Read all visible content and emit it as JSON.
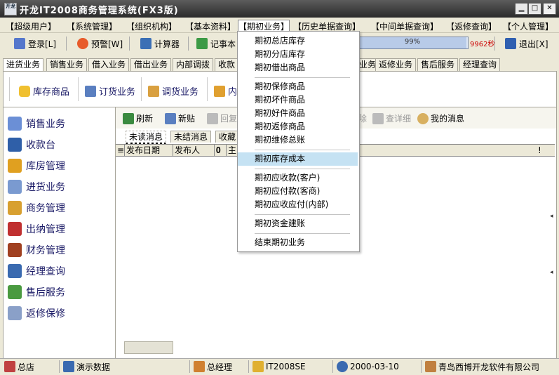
{
  "window": {
    "title": "开龙IT2008商务管理系统(FX3版)",
    "app_icon_text": "开龙",
    "minimize": "▁",
    "maximize": "□",
    "close": "✕"
  },
  "menubar": [
    "【超级用户】",
    "【系统管理】",
    "【组织机构】",
    "【基本资料】",
    "【期初业务】",
    "【历史单据查询】",
    "【中间单据查询】",
    "【返修查询】",
    "【个人管理】"
  ],
  "toolbar": {
    "login": "登录[L]",
    "alert": "预警[W]",
    "calculator": "计算器",
    "notepad": "记事本",
    "progress_text": "99%",
    "progress_value": 0.99,
    "sms_count": "9962秒",
    "logout": "退出[X]"
  },
  "tabs": [
    "进货业务",
    "销售业务",
    "借入业务",
    "借出业务",
    "内部调拨",
    "收款",
    "业务",
    "返修业务",
    "售后服务",
    "经理查询"
  ],
  "subpanel": {
    "inventory": "库存商品",
    "order": "订货业务",
    "transfer": "调货业务",
    "internal": "内"
  },
  "leftnav": [
    "销售业务",
    "收款台",
    "库房管理",
    "进货业务",
    "商务管理",
    "出纳管理",
    "财务管理",
    "经理查询",
    "售后服务",
    "返修保修"
  ],
  "main_toolbar": {
    "refresh": "刷新",
    "new_post": "新贴",
    "reply": "回复",
    "delete": "除",
    "details": "查详细",
    "my_messages": "我的消息"
  },
  "message_tabs": [
    "未读消息",
    "未结消息",
    "收藏"
  ],
  "grid_columns": [
    "发布日期",
    "发布人",
    "主"
  ],
  "dropdown": {
    "group1": [
      "期初总店库存",
      "期初分店库存",
      "期初借出商品"
    ],
    "group2": [
      "期初保修商品",
      "期初坏件商品",
      "期初好件商品",
      "期初返修商品",
      "期初维修总账"
    ],
    "group3": [
      "期初库存成本"
    ],
    "group4": [
      "期初应收款(客户)",
      "期初应付款(客商)",
      "期初应收应付(内部)"
    ],
    "group5": [
      "期初资金建账"
    ],
    "group6": [
      "结束期初业务"
    ]
  },
  "statusbar": {
    "branch": "总店",
    "demo": "演示数据",
    "role": "总经理",
    "product": "IT2008SE",
    "date": "2000-03-10",
    "company": "青岛西博开龙软件有限公司"
  },
  "colors": {
    "titlebar": "#3a3a3a",
    "highlight": "#c5e2f3",
    "nav_text": "#1a1a66",
    "sms_red": "#cc0000"
  }
}
